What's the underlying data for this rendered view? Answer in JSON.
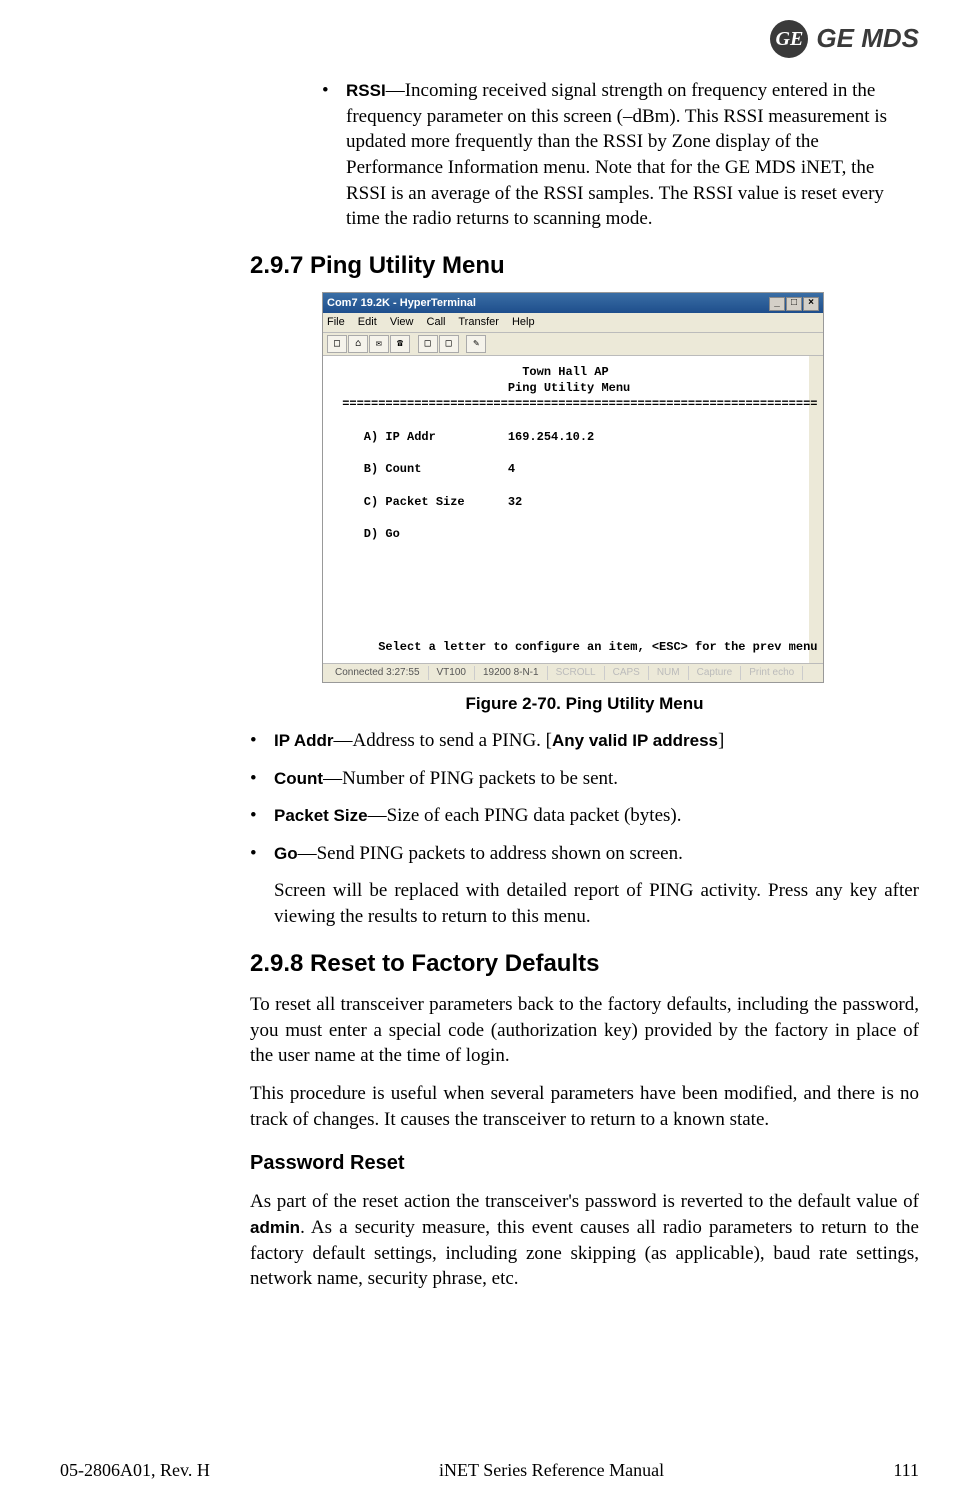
{
  "brand": {
    "circle": "GE",
    "text": "GE MDS"
  },
  "rssi": {
    "label": "RSSI",
    "desc": "—Incoming received signal strength on frequency entered in the frequency parameter on this screen (–dBm). This RSSI measurement is updated more frequently than the RSSI by Zone display of the Performance Information menu. Note that for the GE MDS iNET, the RSSI is an average of the RSSI samples. The RSSI value is reset every time the radio returns to scanning mode."
  },
  "sec297": {
    "title": "2.9.7 Ping Utility Menu",
    "caption": "Figure 2-70. Ping Utility Menu",
    "window": {
      "title": "Com7 19.2K - HyperTerminal",
      "menu": [
        "File",
        "Edit",
        "View",
        "Call",
        "Transfer",
        "Help"
      ],
      "term_header_1": "Town Hall AP",
      "term_header_2": "Ping Utility Menu",
      "rows": [
        {
          "l": "A) IP Addr",
          "v": "169.254.10.2"
        },
        {
          "l": "B) Count",
          "v": "4"
        },
        {
          "l": "C) Packet Size",
          "v": "32"
        },
        {
          "l": "D) Go",
          "v": ""
        }
      ],
      "prompt": "Select a letter to configure an item, <ESC> for the prev menu",
      "status": {
        "conn": "Connected 3:27:55",
        "emu": "VT100",
        "baud": "19200 8-N-1",
        "f1": "SCROLL",
        "f2": "CAPS",
        "f3": "NUM",
        "f4": "Capture",
        "f5": "Print echo"
      }
    },
    "items": {
      "ip_label": "IP Addr",
      "ip_desc": "—Address to send a PING. [",
      "ip_hint": "Any valid IP address",
      "ip_close": "]",
      "count_label": "Count",
      "count_desc": "—Number of PING packets to be sent.",
      "ps_label": "Packet Size",
      "ps_desc": "—Size of each PING data packet (bytes).",
      "go_label": "Go",
      "go_desc": "—Send PING packets to address shown on screen.",
      "note": "Screen will be replaced with detailed report of PING activity. Press any key after viewing the results to return to this menu."
    }
  },
  "sec298": {
    "title": "2.9.8 Reset to Factory Defaults",
    "p1": "To reset all transceiver parameters back to the factory defaults, including the password, you must enter a special code (authorization key) provided by the factory in place of the user name at the time of login.",
    "p2": "This procedure is useful when several parameters have been modified, and there is no track of changes. It causes the transceiver to return to a known state.",
    "pwreset_title": "Password Reset",
    "pwreset_p1a": "As part of the reset action the transceiver's password is reverted to the default value of ",
    "pwreset_admin": "admin",
    "pwreset_p1b": ". As a security measure, this event causes all radio parameters to return to the factory default settings, including zone skipping (as applicable), baud rate settings, network name, security phrase, etc."
  },
  "footer": {
    "left": "05-2806A01, Rev. H",
    "center": "iNET Series Reference Manual",
    "right": "111"
  }
}
